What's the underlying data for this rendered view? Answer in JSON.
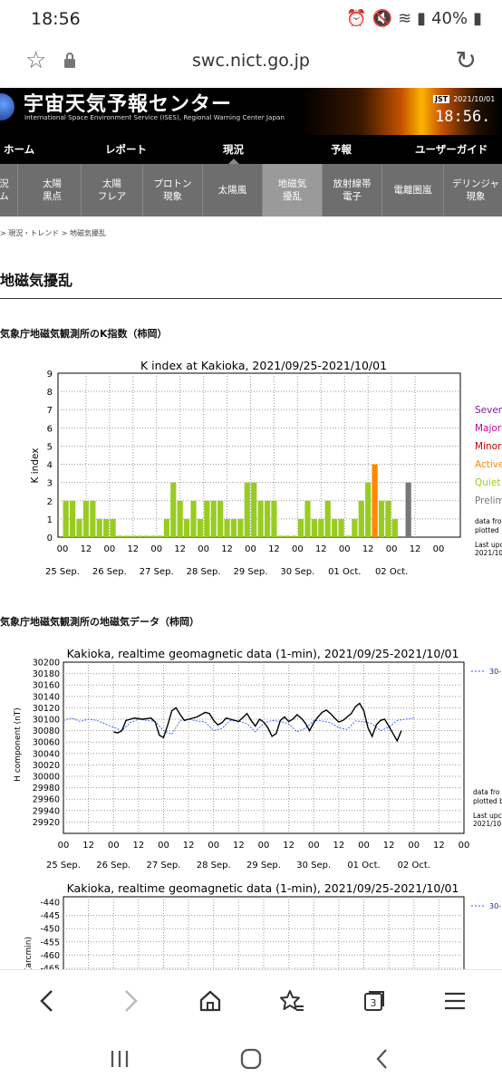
{
  "status": {
    "time": "18:56",
    "battery": "40%"
  },
  "browser": {
    "url": "swc.nict.go.jp",
    "tab_count": "3"
  },
  "banner": {
    "title": "宇宙天気予報センター",
    "subtitle": "International Space Environment Service (ISES), Regional Warning Center Japan",
    "jst_label": "JST",
    "date": "2021/10/01",
    "clock": "18:56."
  },
  "main_nav": [
    {
      "label": "ホーム"
    },
    {
      "label": "レポート"
    },
    {
      "label": "現況"
    },
    {
      "label": "予報"
    },
    {
      "label": "ユーザーガイド"
    }
  ],
  "sub_nav": [
    {
      "label": "況\nム"
    },
    {
      "label": "太陽\n黒点"
    },
    {
      "label": "太陽\nフレア"
    },
    {
      "label": "プロトン\n現象"
    },
    {
      "label": "太陽風"
    },
    {
      "label": "地磁気\n擾乱"
    },
    {
      "label": "放射線帯\n電子"
    },
    {
      "label": "電離圏嵐"
    },
    {
      "label": "デリンジャ\n現象"
    }
  ],
  "breadcrumb": ">  現況・トレンド  >  地磁気擾乱",
  "page_title": "地磁気擾乱",
  "section1_title": "気象庁地磁気観測所のK指数（柿岡）",
  "section2_title": "気象庁地磁気観測所の地磁気データ（柿岡）",
  "colors": {
    "quiet": "#99cc22",
    "active": "#ff8800",
    "minor": "#cc0000",
    "major": "#cc00aa",
    "severe": "#7a1fa8",
    "prelim": "#777777"
  },
  "chart_data": [
    {
      "type": "bar",
      "title": "K index at Kakioka, 2021/09/25-2021/10/01",
      "ylabel": "K index",
      "ylim": [
        0,
        9
      ],
      "yticks": [
        "0",
        "1",
        "2",
        "3",
        "4",
        "5",
        "6",
        "7",
        "8",
        "9"
      ],
      "xticks": [
        "00",
        "12",
        "00",
        "12",
        "00",
        "12",
        "00",
        "12",
        "00",
        "12",
        "00",
        "12",
        "00",
        "12",
        "00",
        "12",
        "00"
      ],
      "day_labels": [
        "25 Sep.",
        "26 Sep.",
        "27 Sep.",
        "28 Sep.",
        "29 Sep.",
        "30 Sep.",
        "01 Oct.",
        "02 Oct."
      ],
      "values": [
        2,
        2,
        1,
        2,
        2,
        1,
        1,
        1,
        0,
        0,
        0,
        0,
        0,
        0,
        0,
        1,
        3,
        2,
        1,
        2,
        1,
        2,
        2,
        2,
        1,
        1,
        1,
        3,
        3,
        2,
        2,
        2,
        0,
        0,
        0,
        1,
        2,
        1,
        1,
        2,
        1,
        1,
        0,
        1,
        2,
        3,
        4,
        2,
        2,
        1,
        null,
        3
      ],
      "categories_per_bar": "3-hour intervals",
      "bar_status": [
        "quiet",
        "quiet",
        "quiet",
        "quiet",
        "quiet",
        "quiet",
        "quiet",
        "quiet",
        "quiet",
        "quiet",
        "quiet",
        "quiet",
        "quiet",
        "quiet",
        "quiet",
        "quiet",
        "quiet",
        "quiet",
        "quiet",
        "quiet",
        "quiet",
        "quiet",
        "quiet",
        "quiet",
        "quiet",
        "quiet",
        "quiet",
        "quiet",
        "quiet",
        "quiet",
        "quiet",
        "quiet",
        "quiet",
        "quiet",
        "quiet",
        "quiet",
        "quiet",
        "quiet",
        "quiet",
        "quiet",
        "quiet",
        "quiet",
        "quiet",
        "quiet",
        "quiet",
        "quiet",
        "active",
        "quiet",
        "quiet",
        "quiet",
        "none",
        "prelim"
      ],
      "legend": [
        {
          "label": "Sever",
          "status": "severe"
        },
        {
          "label": "Major",
          "status": "major"
        },
        {
          "label": "Minor",
          "status": "minor"
        },
        {
          "label": "Active",
          "status": "active"
        },
        {
          "label": "Quiet",
          "status": "quiet"
        },
        {
          "label": "Prelim",
          "status": "prelim"
        }
      ],
      "note1": "data from",
      "note2": "plotted",
      "note3": "Last upd",
      "note4": "2021/10"
    },
    {
      "type": "line",
      "title": "Kakioka, realtime geomagnetic data (1-min), 2021/09/25-2021/10/01",
      "ylabel": "H component (nT)",
      "ylim": [
        29900,
        30200
      ],
      "yticks": [
        "30200",
        "30180",
        "30160",
        "30140",
        "30120",
        "30100",
        "30080",
        "30060",
        "30040",
        "30020",
        "30000",
        "29980",
        "29960",
        "29940",
        "29920"
      ],
      "xticks": [
        "00",
        "12",
        "00",
        "12",
        "00",
        "12",
        "00",
        "12",
        "00",
        "12",
        "00",
        "12",
        "00",
        "12",
        "00",
        "12",
        "00"
      ],
      "day_labels": [
        "25 Sep.",
        "26 Sep.",
        "27 Sep.",
        "28 Sep.",
        "29 Sep.",
        "30 Sep.",
        "01 Oct.",
        "02 Oct."
      ],
      "legend_label": "30-",
      "note1": "data fro",
      "note2": "plotted b",
      "note3": "Last upc",
      "note4": "2021/10",
      "series": [
        {
          "x_hours": [
            0,
            6,
            12,
            16,
            18,
            20,
            22,
            24,
            26,
            28,
            30,
            34,
            38,
            42,
            44,
            46,
            48,
            50,
            52,
            54,
            56,
            58,
            60,
            64,
            68,
            70,
            72,
            74,
            76,
            78,
            80,
            84,
            88,
            90,
            92,
            94,
            96,
            98,
            100,
            102,
            104,
            106,
            108,
            110,
            112,
            114,
            116,
            118,
            120,
            122,
            124,
            126,
            128,
            130,
            132,
            134,
            136,
            138,
            140,
            142,
            144,
            146,
            148,
            150,
            152,
            154,
            156,
            158,
            160,
            162,
            164,
            166
          ],
          "values": [
            null,
            null,
            null,
            null,
            null,
            null,
            null,
            30078,
            30076,
            30080,
            30098,
            30102,
            30100,
            30102,
            30095,
            30072,
            30068,
            30090,
            30115,
            30120,
            30108,
            30098,
            30100,
            30104,
            30112,
            30110,
            30098,
            30090,
            30094,
            30102,
            30100,
            30096,
            30110,
            30098,
            30088,
            30100,
            30095,
            30085,
            30070,
            30075,
            30098,
            30104,
            30096,
            30100,
            30108,
            30102,
            30093,
            30080,
            30094,
            30104,
            30112,
            30116,
            30110,
            30102,
            30095,
            30098,
            30104,
            30110,
            30122,
            30128,
            30115,
            30085,
            30070,
            30090,
            30098,
            30100,
            30088,
            30075,
            30062,
            30080,
            null,
            null
          ],
          "color": "#000000"
        },
        {
          "name": "30-",
          "x_hours": [
            0,
            4,
            8,
            12,
            16,
            20,
            24,
            28,
            32,
            36,
            40,
            44,
            48,
            52,
            56,
            60,
            64,
            68,
            72,
            76,
            80,
            84,
            88,
            92,
            96,
            100,
            104,
            108,
            112,
            116,
            120,
            124,
            128,
            132,
            136,
            140,
            144,
            148,
            152,
            156,
            160,
            164,
            168
          ],
          "values": [
            30098,
            30102,
            30096,
            30100,
            30098,
            30092,
            30086,
            30080,
            30094,
            30100,
            30098,
            30096,
            30080,
            30074,
            30098,
            30100,
            30097,
            30095,
            30080,
            30084,
            30098,
            30097,
            30092,
            30078,
            30093,
            30098,
            30096,
            30092,
            30078,
            30084,
            30098,
            30097,
            30094,
            30085,
            30082,
            30097,
            30096,
            30092,
            30080,
            30086,
            30098,
            30100,
            30102
          ],
          "color": "#3355ff"
        }
      ]
    },
    {
      "type": "line",
      "title": "Kakioka, realtime geomagnetic data (1-min), 2021/09/25-2021/10/01",
      "ylabel": "(arcmin)",
      "yticks": [
        "-440",
        "-445",
        "-450",
        "-455",
        "-460",
        "-465"
      ],
      "legend_label": "30-"
    }
  ]
}
